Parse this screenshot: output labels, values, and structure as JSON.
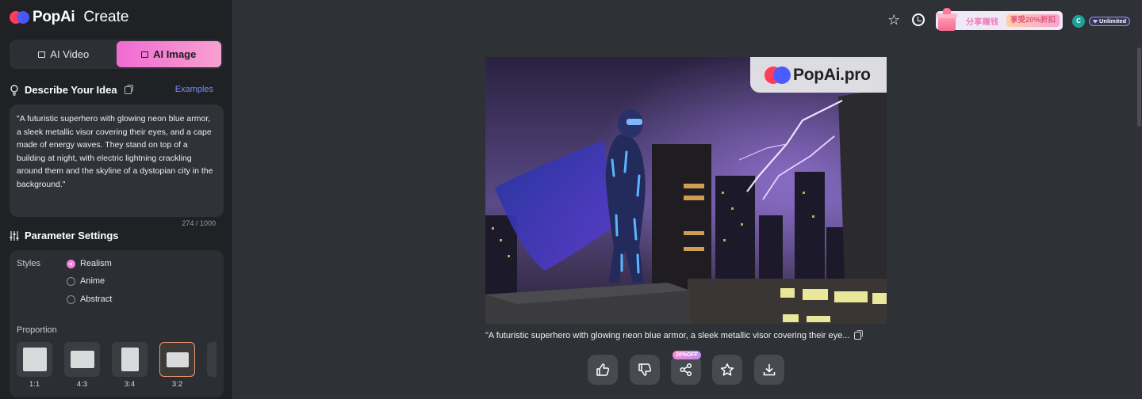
{
  "brand": {
    "name": "PopAi",
    "section": "Create"
  },
  "modes": [
    {
      "label": "AI Video",
      "active": false
    },
    {
      "label": "AI Image",
      "active": true
    }
  ],
  "describe": {
    "title": "Describe Your Idea",
    "examples_link": "Examples",
    "prompt": "\"A futuristic superhero with glowing neon blue armor, a sleek metallic visor covering their eyes, and a cape made of energy waves. They stand on top of a building at night, with electric lightning crackling around them and the skyline of a dystopian city in the background.\"",
    "counter": "274 / 1000"
  },
  "params": {
    "title": "Parameter Settings",
    "styles_label": "Styles",
    "styles": [
      {
        "label": "Realism",
        "checked": true
      },
      {
        "label": "Anime",
        "checked": false
      },
      {
        "label": "Abstract",
        "checked": false
      }
    ],
    "proportion_label": "Proportion",
    "ratios": [
      {
        "label": "1:1",
        "selected": false
      },
      {
        "label": "4:3",
        "selected": false
      },
      {
        "label": "3:4",
        "selected": false
      },
      {
        "label": "3:2",
        "selected": true
      }
    ]
  },
  "topbar": {
    "promo_text": "分享赚钱",
    "promo_badge": "享受20%折扣",
    "avatar_initial": "C",
    "plan": "Unlimited"
  },
  "result": {
    "watermark": "PopAi.pro",
    "caption": "\"A futuristic superhero with glowing neon blue armor, a sleek metallic visor covering their eye...",
    "share_badge": "20%OFF"
  },
  "actions": [
    {
      "name": "like-button",
      "icon": "thumbs-up-icon"
    },
    {
      "name": "dislike-button",
      "icon": "thumbs-down-icon"
    },
    {
      "name": "share-button",
      "icon": "share-icon"
    },
    {
      "name": "favorite-button",
      "icon": "star-icon"
    },
    {
      "name": "download-button",
      "icon": "download-icon"
    }
  ],
  "colors": {
    "accent_pink": "#f06bd3",
    "link_blue": "#7a8aff",
    "sidebar_bg": "#1f2125",
    "main_bg": "#2e3136"
  }
}
